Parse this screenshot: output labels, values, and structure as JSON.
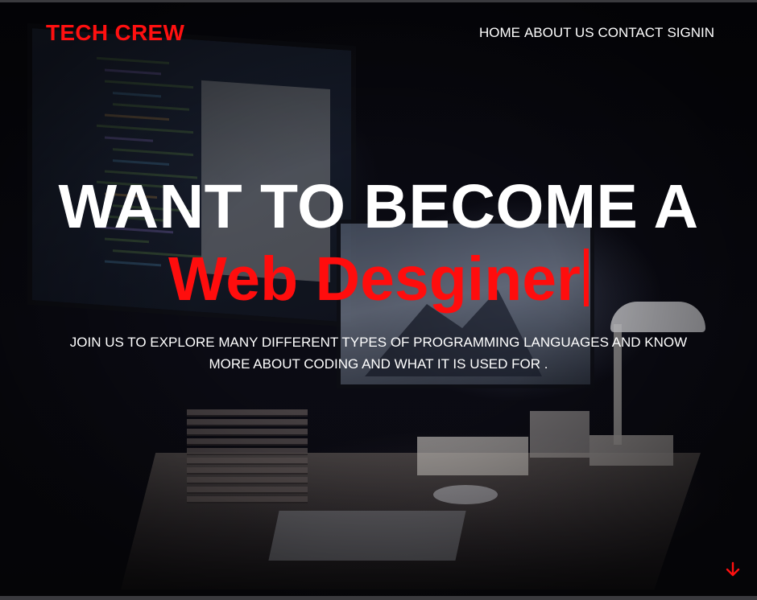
{
  "brand": {
    "name": "TECH CREW"
  },
  "nav": {
    "items": [
      {
        "label": "HOME"
      },
      {
        "label": "ABOUT US"
      },
      {
        "label": "CONTACT"
      },
      {
        "label": "SIGNIN"
      }
    ]
  },
  "hero": {
    "headline": "WANT TO BECOME A",
    "typed_text": "Web Desginer",
    "subtitle_line1": "JOIN US TO EXPLORE MANY DIFFERENT TYPES OF PROGRAMMING LANGUAGES AND KNOW",
    "subtitle_line2": "MORE ABOUT CODING AND WHAT IT IS USED FOR ."
  },
  "icons": {
    "scroll_down": "arrow-down-icon",
    "background": "workspace-photo"
  },
  "colors": {
    "accent": "#ff1010",
    "text": "#ffffff",
    "background": "#0a0a12"
  }
}
